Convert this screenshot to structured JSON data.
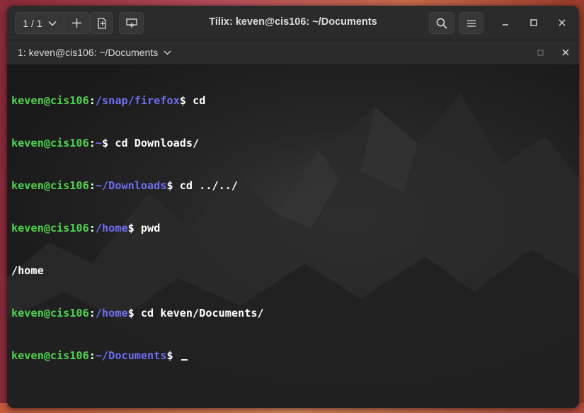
{
  "window": {
    "title": "Tilix: keven@cis106: ~/Documents",
    "session_label": "1 / 1"
  },
  "tab": {
    "title": "1: keven@cis106: ~/Documents"
  },
  "icons": {
    "session_chevron": "chevron-down-icon",
    "add_session": "plus-icon",
    "add_right": "split-right-icon",
    "add_down": "split-down-icon",
    "search": "search-icon",
    "menu": "hamburger-menu-icon",
    "minimize": "minimize-icon",
    "maximize": "maximize-icon",
    "close": "close-icon"
  },
  "colors": {
    "user_host": "#4ed34e",
    "path": "#6d6df2",
    "text": "#ffffff",
    "background": "#1d1d1d"
  },
  "terminal": {
    "lines": [
      {
        "user": "keven@cis106",
        "sep": ":",
        "path": "/snap/firefox",
        "prompt": "$ ",
        "cmd": "cd"
      },
      {
        "user": "keven@cis106",
        "sep": ":",
        "path": "~",
        "prompt": "$ ",
        "cmd": "cd Downloads/"
      },
      {
        "user": "keven@cis106",
        "sep": ":",
        "path": "~/Downloads",
        "prompt": "$ ",
        "cmd": "cd ../../"
      },
      {
        "user": "keven@cis106",
        "sep": ":",
        "path": "/home",
        "prompt": "$ ",
        "cmd": "pwd"
      },
      {
        "output": "/home"
      },
      {
        "user": "keven@cis106",
        "sep": ":",
        "path": "/home",
        "prompt": "$ ",
        "cmd": "cd keven/Documents/"
      },
      {
        "user": "keven@cis106",
        "sep": ":",
        "path": "~/Documents",
        "prompt": "$ ",
        "cmd": ""
      }
    ]
  }
}
